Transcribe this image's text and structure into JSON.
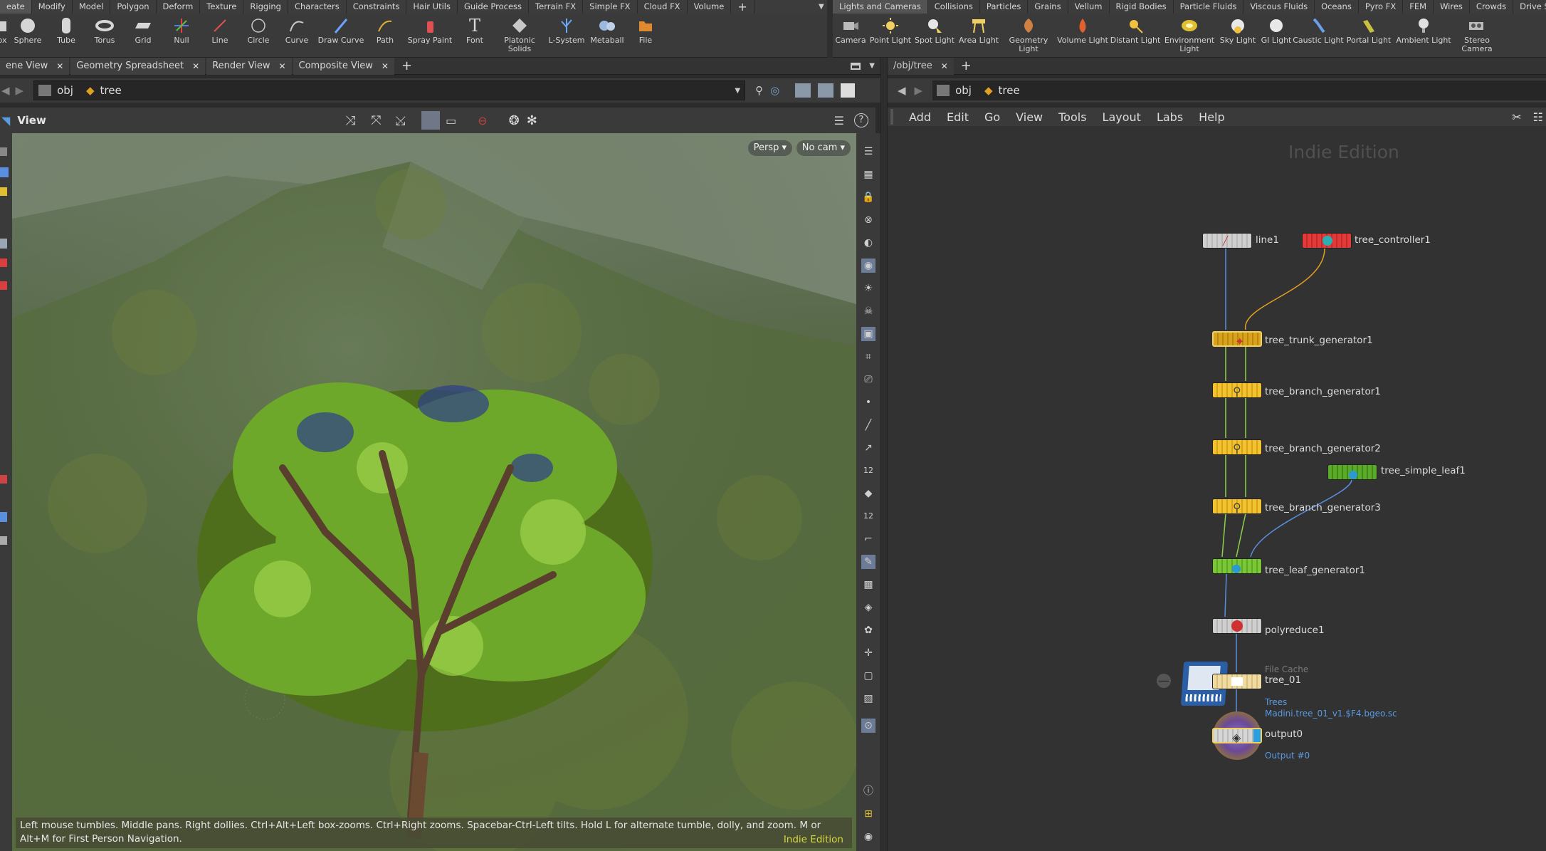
{
  "left_shelf_tabs": [
    "eate",
    "Modify",
    "Model",
    "Polygon",
    "Deform",
    "Texture",
    "Rigging",
    "Characters",
    "Constraints",
    "Hair Utils",
    "Guide Process",
    "Terrain FX",
    "Simple FX",
    "Cloud FX",
    "Volume"
  ],
  "right_shelf_tabs": [
    "Lights and Cameras",
    "Collisions",
    "Particles",
    "Grains",
    "Vellum",
    "Rigid Bodies",
    "Particle Fluids",
    "Viscous Fluids",
    "Oceans",
    "Pyro FX",
    "FEM",
    "Wires",
    "Crowds",
    "Drive Simulation"
  ],
  "left_tools": [
    "ox",
    "Sphere",
    "Tube",
    "Torus",
    "Grid",
    "Null",
    "Line",
    "Circle",
    "Curve",
    "Draw Curve",
    "Path",
    "Spray Paint",
    "Font",
    "Platonic Solids",
    "L-System",
    "Metaball",
    "File"
  ],
  "right_tools": [
    "Camera",
    "Point Light",
    "Spot Light",
    "Area Light",
    "Geometry Light",
    "Volume Light",
    "Distant Light",
    "Environment Light",
    "Sky Light",
    "GI Light",
    "Caustic Light",
    "Portal Light",
    "Ambient Light",
    "Stereo Camera"
  ],
  "pane_tabs": [
    "ene View",
    "Geometry Spreadsheet",
    "Render View",
    "Composite View"
  ],
  "net_tab": "/obj/tree",
  "path": {
    "obj": "obj",
    "tree": "tree"
  },
  "view_label": "View",
  "viewport": {
    "persp": "Persp",
    "cam": "No cam"
  },
  "hint_text": "Left mouse tumbles. Middle pans. Right dollies. Ctrl+Alt+Left box-zooms. Ctrl+Right zooms. Spacebar-Ctrl-Left tilts. Hold L for alternate tumble, dolly, and zoom.    M or Alt+M for First Person Navigation.",
  "edition": "Indie Edition",
  "net_menu": [
    "Add",
    "Edit",
    "Go",
    "View",
    "Tools",
    "Layout",
    "Labs",
    "Help"
  ],
  "nodes": {
    "line1": "line1",
    "tree_controller1": "tree_controller1",
    "tree_trunk_generator1": "tree_trunk_generator1",
    "tree_branch_generator1": "tree_branch_generator1",
    "tree_branch_generator2": "tree_branch_generator2",
    "tree_simple_leaf1": "tree_simple_leaf1",
    "tree_branch_generator3": "tree_branch_generator3",
    "tree_leaf_generator1": "tree_leaf_generator1",
    "polyreduce1": "polyreduce1",
    "file_cache_type": "File Cache",
    "tree_01": "tree_01",
    "tree_01_sub1": "Trees",
    "tree_01_sub2": "Madini.tree_01_v1.$F4.bgeo.sc",
    "output0": "output0",
    "output0_sub": "Output #0"
  },
  "colors": {
    "yellow": "#f2c230",
    "orange": "#d9a21c",
    "green": "#7cc63a",
    "red": "#e23b3b",
    "grey": "#cfcfcf",
    "wire_blue": "#5a8fe0",
    "wire_orange": "#e0a020",
    "wire_green": "#8bd14a"
  }
}
